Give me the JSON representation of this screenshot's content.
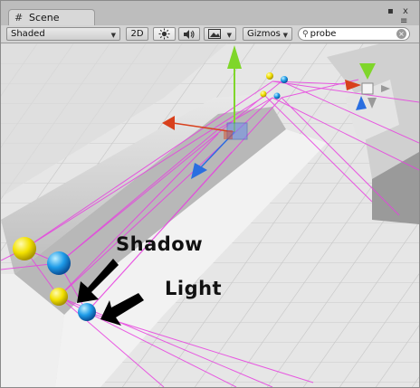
{
  "tab": {
    "title": "Scene"
  },
  "window_controls": {
    "max": "▪",
    "close": "x",
    "menu": "≡"
  },
  "toolbar": {
    "shading_mode": "Shaded",
    "toggle_2d": "2D",
    "gizmos_label": "Gizmos",
    "search_value": "probe"
  },
  "annotations": {
    "shadow_label": "Shadow",
    "light_label": "Light"
  },
  "icons": {
    "tab_icon": "scene-grid-icon",
    "lighting_toggle": "sun-icon",
    "audio_toggle": "speaker-icon",
    "effects_toggle": "image-icon",
    "search_icon": "magnifier-icon",
    "clear_icon": "clear-icon"
  },
  "colors": {
    "probe_shadow": "#f0e000",
    "probe_light": "#1e9be8",
    "probe_lines": "#e840e0",
    "gizmo_y": "#7fd62a",
    "gizmo_x": "#d8401c",
    "gizmo_z": "#2a6ee0"
  }
}
